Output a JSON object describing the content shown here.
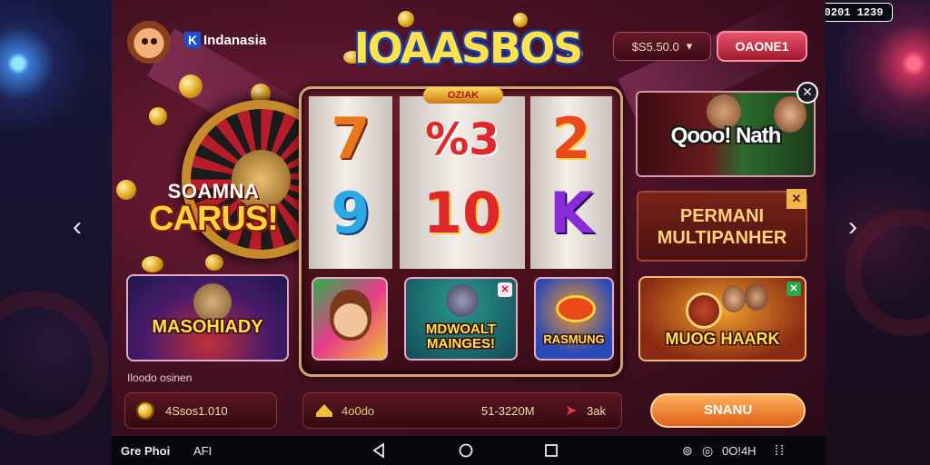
{
  "status_bar": {
    "icons": [
      "▣",
      "⊠",
      "▂▄▆",
      "▮"
    ],
    "pill_text": "S8S0201  1239"
  },
  "header": {
    "brand_name": "Indanasia",
    "brand_mark": "K",
    "logo_text": "IOAASBOS",
    "balance": "$S5.50.0",
    "balance_caret": "▾",
    "deposit_label": "OAONE1"
  },
  "promo": {
    "line1": "SOAMNA",
    "line2": "CARUS!"
  },
  "slot": {
    "top_badge": "OZIAK",
    "reels": [
      [
        "7",
        "9"
      ],
      [
        "%3",
        "10"
      ],
      [
        "2",
        "K"
      ]
    ]
  },
  "tiles": {
    "left": "MASOHIADY",
    "center_1": "",
    "center_2": "MDWOALT MAINGES!",
    "center_3": "RASMUNG",
    "right": "MUOG HAARK"
  },
  "video": {
    "title": "Qooo! Nath"
  },
  "multiplayer": {
    "line1": "PERMANI",
    "line2": "MULTIPANHER"
  },
  "bottom": {
    "label": "Iloodo osinen",
    "coin_value": "4Ssos1.010",
    "bet_value": "4o0do",
    "win_value": "51-3220M",
    "bet_action": "3ak",
    "play_label": "SNANU"
  },
  "navbar": {
    "left_text": "Gre Phoi",
    "left_sub": "AFI",
    "right_text": "0O!4H"
  },
  "colors": {
    "accent_gold": "#ffd33a",
    "brand_blue": "#1c4fd8",
    "play_orange": "#e0601a",
    "deposit_red": "#a01a30"
  }
}
